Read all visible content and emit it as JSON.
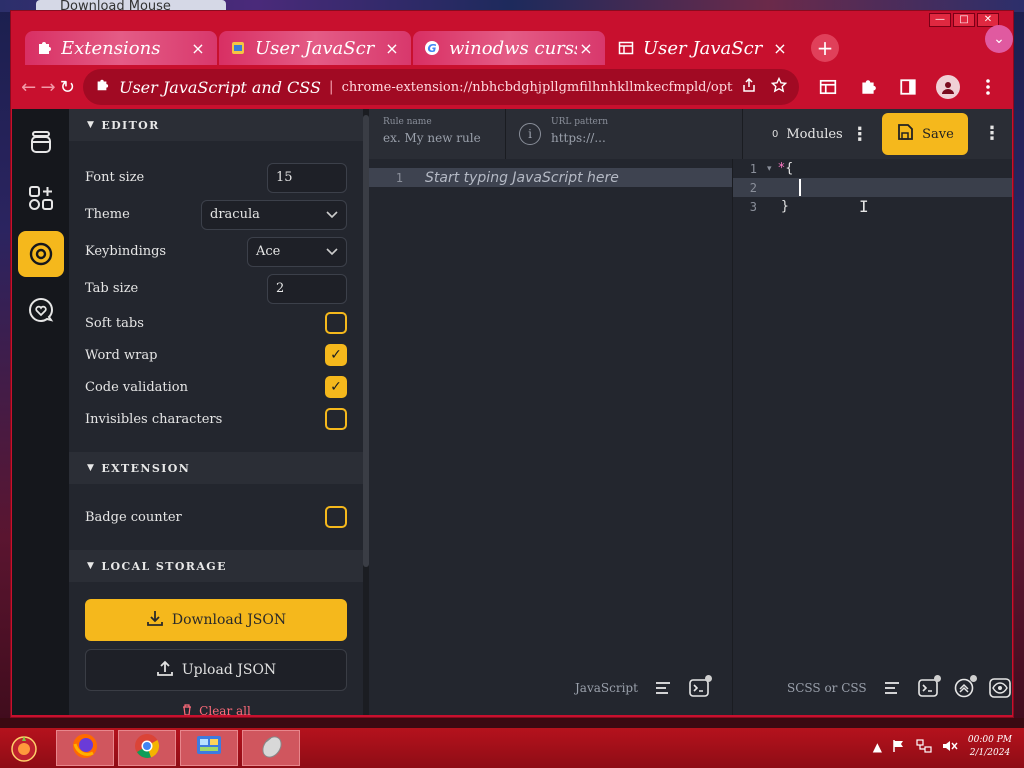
{
  "background_window": {
    "title": "Download Mouse"
  },
  "window_controls": {
    "minimize": "—",
    "maximize": "□",
    "close": "✕"
  },
  "tabs": [
    {
      "title": "Extensions",
      "icon": "puzzle-icon",
      "close": "×"
    },
    {
      "title": "User JavaScr",
      "icon": "bookmark-icon",
      "close": "×"
    },
    {
      "title": "winodws curssc",
      "icon": "google-icon",
      "close": "×"
    },
    {
      "title": "User JavaScr",
      "icon": "table-icon",
      "close": "×",
      "active": true
    }
  ],
  "new_tab": "+",
  "tab_search": "⌄",
  "toolbar": {
    "back": "←",
    "forward": "→",
    "reload": "↻",
    "site_name": "User JavaScript and CSS",
    "separator": "|",
    "url": "chrome-extension://nbhcbdghjpllgmfilhnhkllmkecfmpld/options.html#settings"
  },
  "settings": {
    "editor_section": "Editor",
    "font_size_label": "Font size",
    "font_size_value": "15",
    "theme_label": "Theme",
    "theme_value": "dracula",
    "keybindings_label": "Keybindings",
    "keybindings_value": "Ace",
    "tab_size_label": "Tab size",
    "tab_size_value": "2",
    "soft_tabs_label": "Soft tabs",
    "soft_tabs": false,
    "word_wrap_label": "Word wrap",
    "word_wrap": true,
    "code_validation_label": "Code validation",
    "code_validation": true,
    "invisibles_label": "Invisibles characters",
    "invisibles": false,
    "extension_section": "Extension",
    "badge_counter_label": "Badge counter",
    "badge_counter": false,
    "storage_section": "Local storage",
    "download_json": "Download JSON",
    "upload_json": "Upload JSON",
    "clear_label": "Clear all"
  },
  "editor": {
    "rule_name_label": "Rule name",
    "rule_name_placeholder": "ex. My new rule",
    "url_pattern_label": "URL pattern",
    "url_pattern_placeholder": "https://...",
    "modules_count": "0",
    "modules_label": "Modules",
    "save_label": "Save",
    "js_placeholder": "Start typing JavaScript here",
    "js_line_numbers": [
      "1"
    ],
    "css_line_numbers": [
      "1",
      "2",
      "3"
    ],
    "css_line1_selector": "*",
    "css_line1_brace": "{",
    "css_line3": "}",
    "js_mode": "JavaScript",
    "css_mode": "SCSS or CSS"
  },
  "taskbar": {
    "clock_time": "00:00 PM",
    "clock_date": "2/1/2024"
  },
  "colors": {
    "accent": "#f5b81c",
    "browser_frame": "#c8102e",
    "app_bg": "#23262e",
    "rail_bg": "#15171c",
    "taskbar": "#b5121d"
  }
}
